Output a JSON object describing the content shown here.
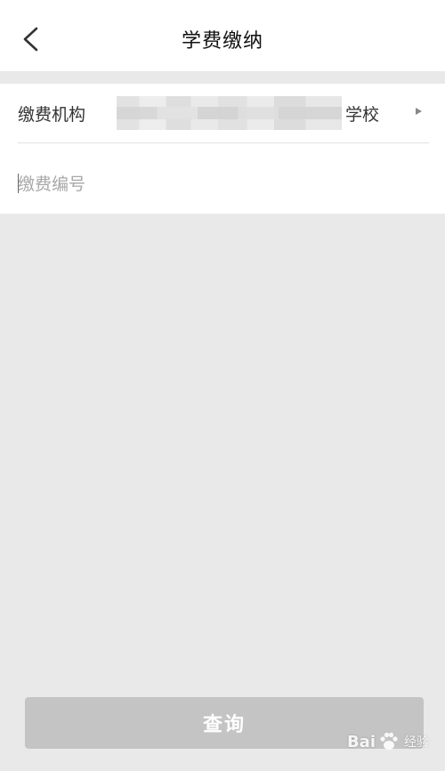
{
  "header": {
    "title": "学费缴纳",
    "back_icon": "chevron-left-icon"
  },
  "form": {
    "institution_label": "缴费机构",
    "institution_suffix": "学校",
    "institution_arrow_icon": "triangle-right-icon",
    "payment_number_placeholder": "缴费编号",
    "payment_number_value": ""
  },
  "actions": {
    "query_label": "查询"
  },
  "watermark": {
    "brand": "Bai",
    "brand_tail": "经验",
    "logo_icon": "paw-icon"
  },
  "colors": {
    "background": "#e9e9e9",
    "card": "#ffffff",
    "button_disabled": "#c4c4c4",
    "placeholder": "#a8a8a8"
  }
}
